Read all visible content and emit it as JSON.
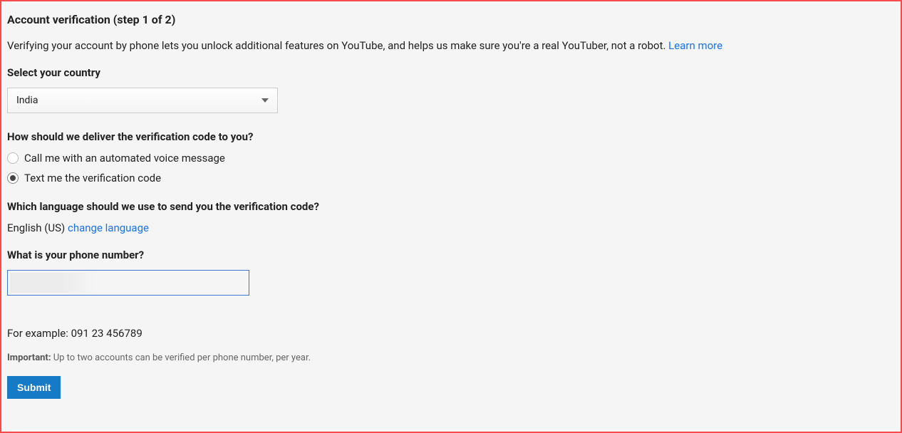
{
  "title": "Account verification (step 1 of 2)",
  "description_text": "Verifying your account by phone lets you unlock additional features on YouTube, and helps us make sure you're a real YouTuber, not a robot. ",
  "learn_more": "Learn more",
  "country": {
    "label": "Select your country",
    "value": "India"
  },
  "delivery": {
    "label": "How should we deliver the verification code to you?",
    "options": [
      {
        "label": "Call me with an automated voice message",
        "selected": false
      },
      {
        "label": "Text me the verification code",
        "selected": true
      }
    ]
  },
  "language": {
    "label": "Which language should we use to send you the verification code?",
    "value": "English (US)",
    "change_link": "change language"
  },
  "phone": {
    "label": "What is your phone number?",
    "value": "",
    "example": "For example: 091 23 456789"
  },
  "important": {
    "bold": "Important:",
    "text": " Up to two accounts can be verified per phone number, per year."
  },
  "submit_label": "Submit"
}
